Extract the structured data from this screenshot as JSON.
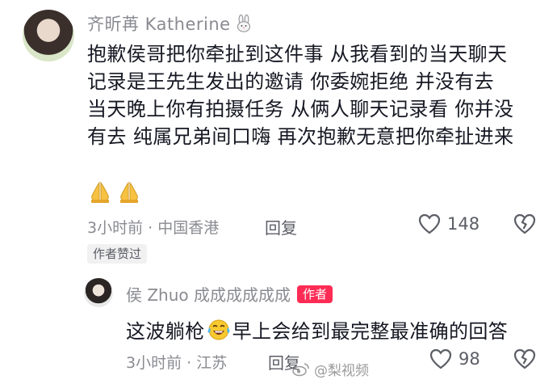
{
  "comment": {
    "author": "齐昕苒 Katherine",
    "author_emoji": "bunny-icon",
    "body_lines": [
      "抱歉侯哥把你牵扯到这件事 从我看到的当天聊天",
      "记录是王先生发出的邀请 你委婉拒绝 并没有去",
      "当天晚上你有拍摄任务 从俩人聊天记录看 你并没",
      "有去 纯属兄弟间口嗨 再次抱歉无意把你牵扯进来"
    ],
    "emojis": [
      "pray-icon",
      "pray-icon"
    ],
    "meta": "3小时前 · 中国香港",
    "reply_label": "回复",
    "likes": "148",
    "author_liked_tag": "作者赞过"
  },
  "reply": {
    "author": "侯 Zhuo 成成成成成成",
    "badge": "作者",
    "text_before": "这波躺枪",
    "emoji": "laughing-tears-icon",
    "text_after": "早上会给到最完整最准确的回答",
    "meta": "3小时前 · 江苏",
    "reply_label": "回复",
    "likes": "98"
  },
  "watermark": {
    "text": "@梨视频"
  },
  "colors": {
    "primary_text": "#161823",
    "secondary_text": "#8a8b91",
    "badge": "#fe2c55"
  }
}
